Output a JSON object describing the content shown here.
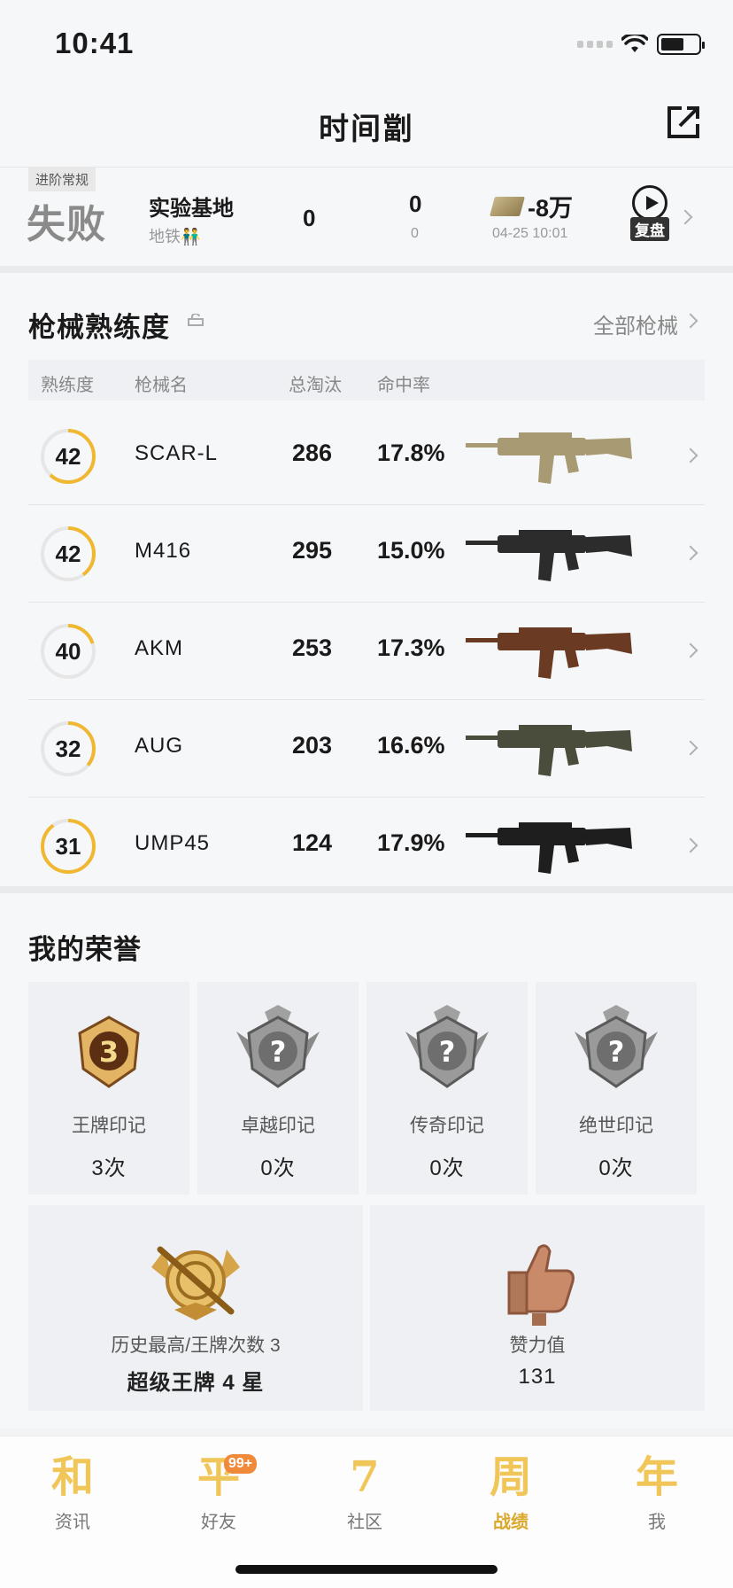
{
  "status_bar": {
    "time": "10:41"
  },
  "header": {
    "title": "时间劏"
  },
  "match": {
    "tag": "进阶常规",
    "result": "失败",
    "map": "实验基地",
    "mode": "地铁👬",
    "kills": "0",
    "stat2": "0",
    "stat2_sub": "0",
    "money": "-8万",
    "date": "04-25 10:01",
    "replay_label": "复盘"
  },
  "weapons": {
    "title": "枪械熟练度",
    "all_label": "全部枪械",
    "columns": [
      "熟练度",
      "枪械名",
      "总淘汰",
      "命中率"
    ],
    "rows": [
      {
        "level": "42",
        "level_progress": 0.62,
        "name": "SCAR-L",
        "kills": "286",
        "accuracy": "17.8%",
        "color": "#a89a72"
      },
      {
        "level": "42",
        "level_progress": 0.4,
        "name": "M416",
        "kills": "295",
        "accuracy": "15.0%",
        "color": "#2c2c2c"
      },
      {
        "level": "40",
        "level_progress": 0.2,
        "name": "AKM",
        "kills": "253",
        "accuracy": "17.3%",
        "color": "#6b3a22"
      },
      {
        "level": "32",
        "level_progress": 0.36,
        "name": "AUG",
        "kills": "203",
        "accuracy": "16.6%",
        "color": "#4a4d3b"
      },
      {
        "level": "31",
        "level_progress": 0.9,
        "name": "UMP45",
        "kills": "124",
        "accuracy": "17.9%",
        "color": "#1e1e1e"
      }
    ]
  },
  "honor": {
    "title": "我的荣誉",
    "badges": [
      {
        "name": "王牌印记",
        "count": "3次",
        "icon": "ace-badge-icon",
        "rank": "3"
      },
      {
        "name": "卓越印记",
        "count": "0次",
        "icon": "excellence-badge-icon",
        "rank": "?"
      },
      {
        "name": "传奇印记",
        "count": "0次",
        "icon": "legend-badge-icon",
        "rank": "?"
      },
      {
        "name": "绝世印记",
        "count": "0次",
        "icon": "peerless-badge-icon",
        "rank": "?"
      }
    ],
    "highest": {
      "label": "历史最高/王牌次数 3",
      "value": "超级王牌 4 星"
    },
    "likes": {
      "label": "赞力值",
      "value": "131"
    }
  },
  "tabbar": {
    "items": [
      {
        "glyph": "和",
        "label": "资讯"
      },
      {
        "glyph": "平",
        "label": "好友",
        "badge": "99+"
      },
      {
        "glyph": "7",
        "label": "社区"
      },
      {
        "glyph": "周",
        "label": "战绩",
        "active": true
      },
      {
        "glyph": "年",
        "label": "我"
      }
    ]
  },
  "colors": {
    "accent": "#f1c659",
    "ring": "#f0b830",
    "active_tab": "#d9a82a",
    "badge": "#f08a3a"
  }
}
